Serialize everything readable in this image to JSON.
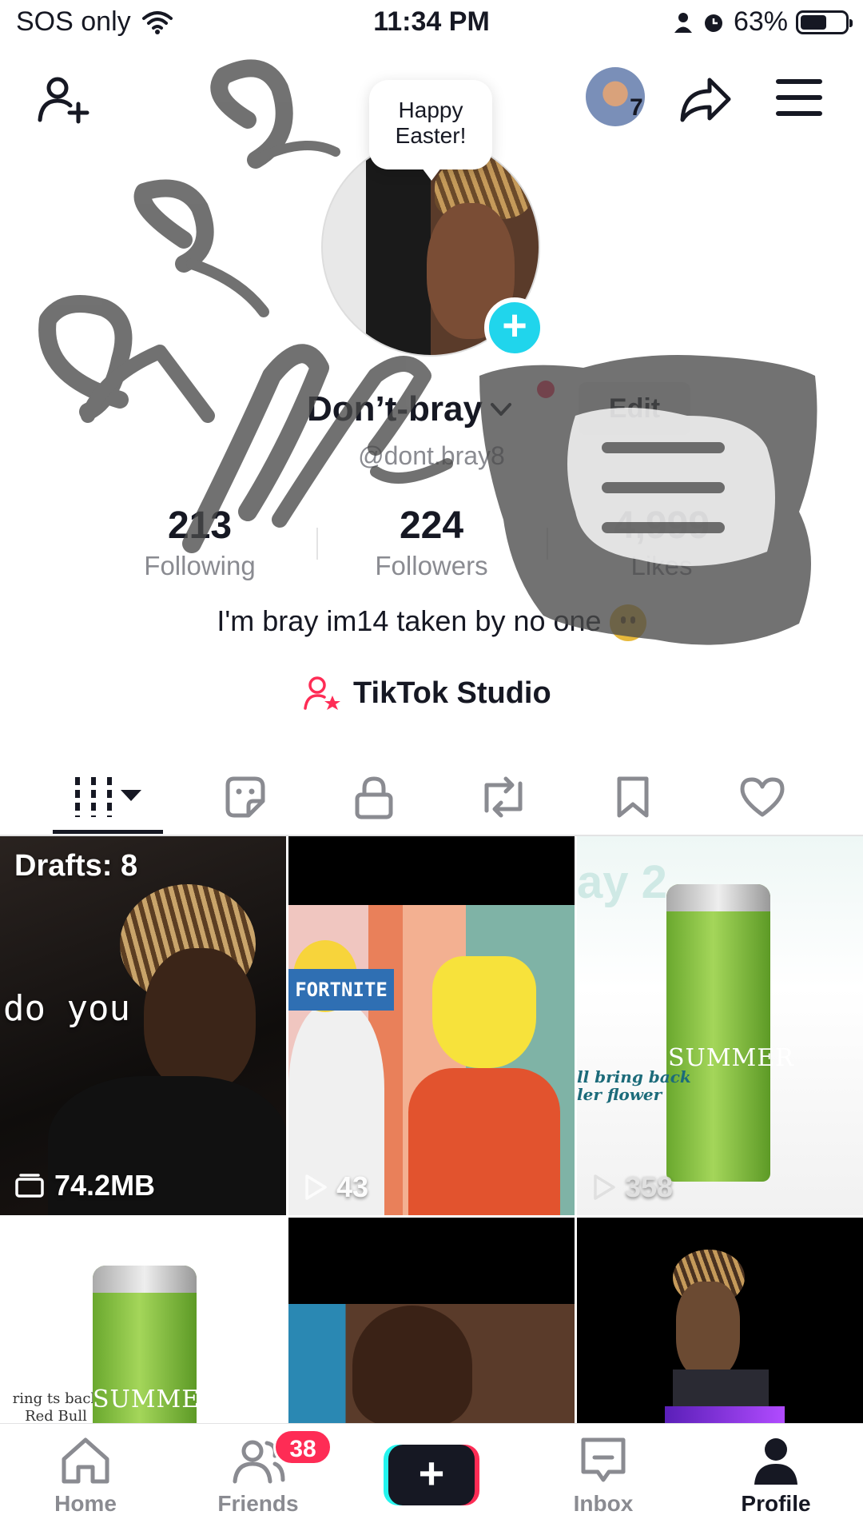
{
  "status_bar": {
    "carrier": "SOS only",
    "time": "11:34 PM",
    "battery": "63%",
    "battery_level": 0.63
  },
  "header": {
    "visitor_count": "7",
    "bubble_text": "Happy Easter!"
  },
  "profile": {
    "display_name": "Don’t-bray",
    "edit_label": "Edit",
    "handle": "@dont.bray8",
    "stats": [
      {
        "value": "213",
        "label": "Following"
      },
      {
        "value": "224",
        "label": "Followers"
      },
      {
        "value": "4,999",
        "label": "Likes"
      }
    ],
    "bio": "I'm bray im14 taken by no one",
    "studio_label": "TikTok Studio"
  },
  "tabs": [
    "videos",
    "stickers",
    "private",
    "reposts",
    "favorites",
    "liked"
  ],
  "grid": {
    "drafts_label": "Drafts: 8",
    "drafts_size": "74.2MB",
    "tile1_caption": "do you",
    "tile2_sign": "FORTNITE",
    "tile2_views": "43",
    "tile3_heading": "ay 2",
    "tile3_caption": "ll bring back\nler flower",
    "tile3_views": "358",
    "tile3_can_text": "SUMMER",
    "tile4_caption": "ring ts back Red Bull",
    "tile4_can_text": "SUMMER"
  },
  "nav": {
    "home": "Home",
    "friends": "Friends",
    "friends_badge": "38",
    "inbox": "Inbox",
    "profile": "Profile"
  },
  "colors": {
    "accent_pink": "#fe2c55",
    "accent_cyan": "#20d5ec",
    "text": "#161823",
    "muted": "#8a8b91"
  }
}
